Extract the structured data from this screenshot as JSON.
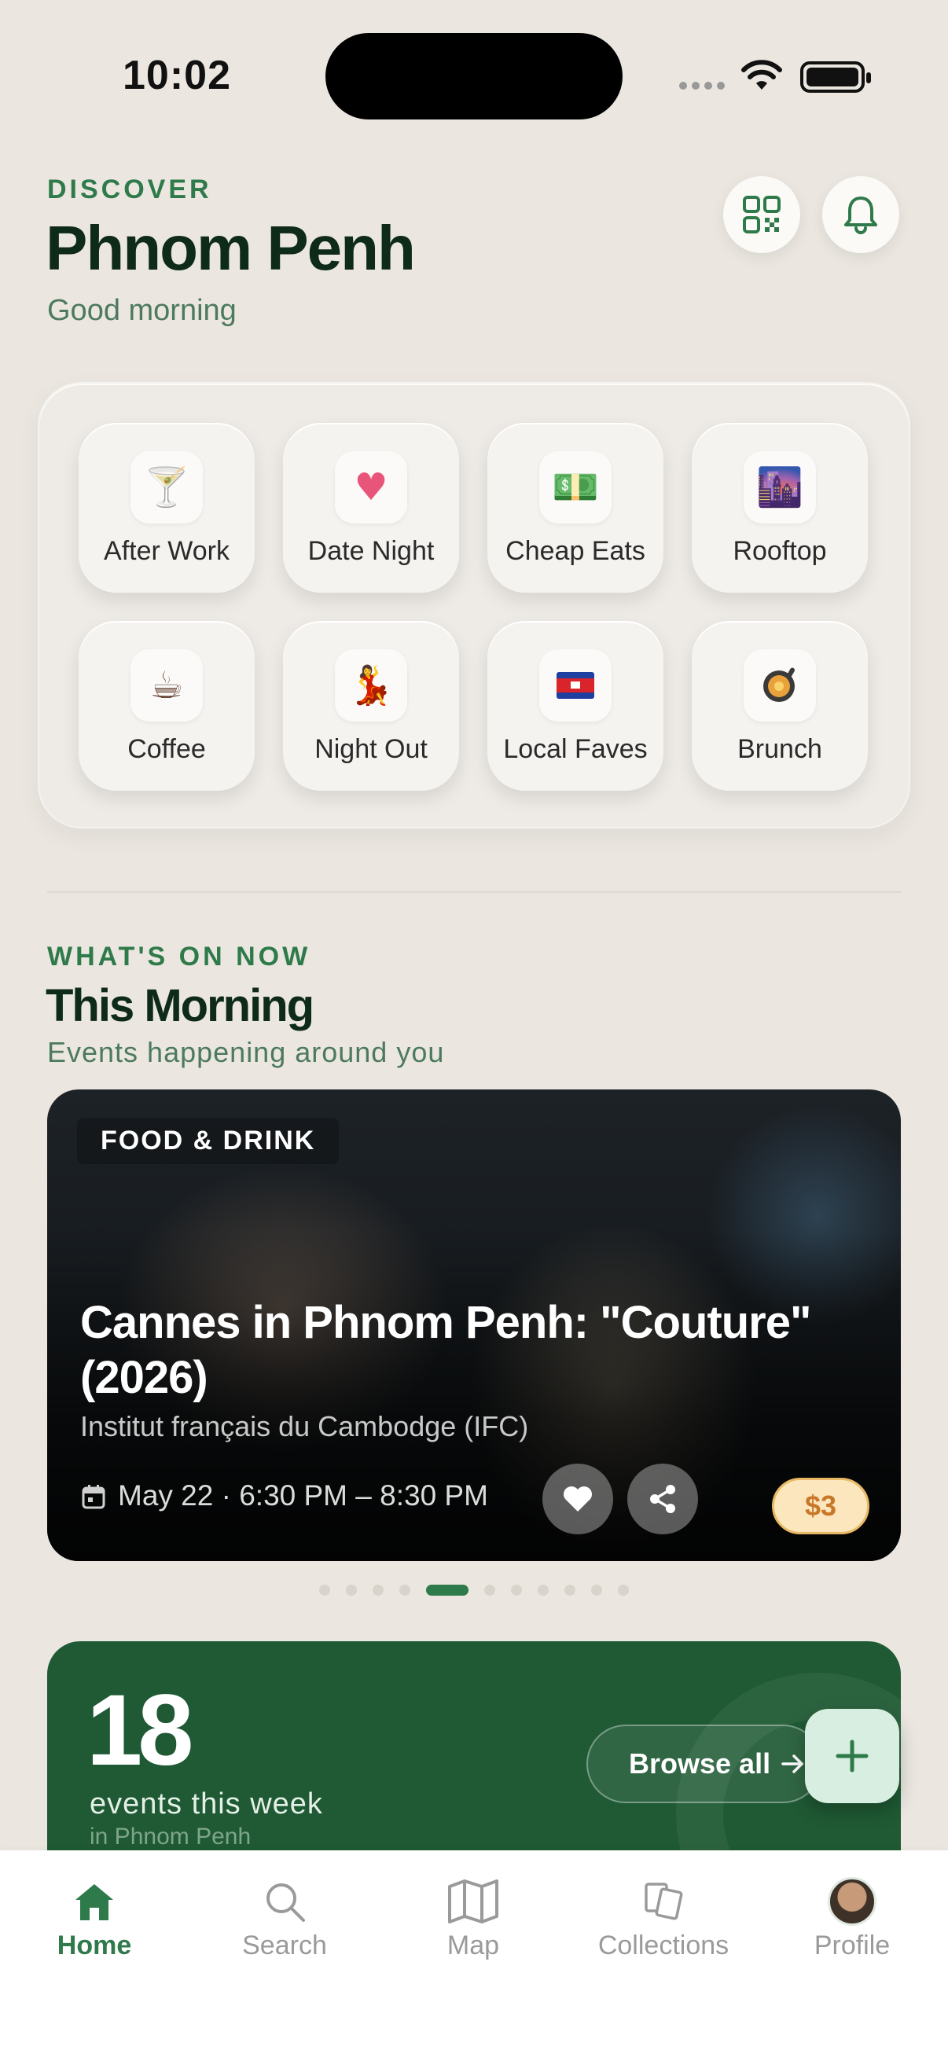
{
  "status_bar": {
    "time": "10:02"
  },
  "header": {
    "eyebrow": "DISCOVER",
    "city": "Phnom Penh",
    "greeting": "Good morning",
    "icons": [
      "qr-code-icon",
      "bell-icon"
    ]
  },
  "categories": [
    {
      "label": "After Work",
      "emoji": "🍸"
    },
    {
      "label": "Date Night",
      "emoji": "♥"
    },
    {
      "label": "Cheap Eats",
      "emoji": "💵"
    },
    {
      "label": "Rooftop",
      "emoji": "🌆"
    },
    {
      "label": "Coffee",
      "emoji": "☕"
    },
    {
      "label": "Night Out",
      "emoji": "💃"
    },
    {
      "label": "Local Faves",
      "emoji": "🇰🇭"
    },
    {
      "label": "Brunch",
      "emoji": "🍳"
    }
  ],
  "whats_on": {
    "eyebrow": "WHAT'S ON NOW",
    "title": "This Morning",
    "subtitle": "Events happening around you"
  },
  "event": {
    "category": "FOOD & DRINK",
    "title": "Cannes in Phnom Penh: \"Couture\" (2026)",
    "venue": "Institut français du Cambodge (IFC)",
    "date": "May 22 · 6:30 PM – 8:30 PM",
    "price": "$3"
  },
  "carousel": {
    "total": 11,
    "active_index": 4
  },
  "stats": {
    "count": "18",
    "label": "events this week",
    "sub": "in Phnom Penh",
    "browse": "Browse all"
  },
  "tabs": [
    {
      "label": "Home",
      "icon": "home-icon",
      "active": true
    },
    {
      "label": "Search",
      "icon": "search-icon",
      "active": false
    },
    {
      "label": "Map",
      "icon": "map-icon",
      "active": false
    },
    {
      "label": "Collections",
      "icon": "collections-icon",
      "active": false
    },
    {
      "label": "Profile",
      "icon": "avatar",
      "active": false
    }
  ],
  "colors": {
    "accent": "#2f7a4a",
    "dark_green": "#1f5a34",
    "background": "#ebe7e0",
    "price_bg": "#fbe6bd"
  }
}
